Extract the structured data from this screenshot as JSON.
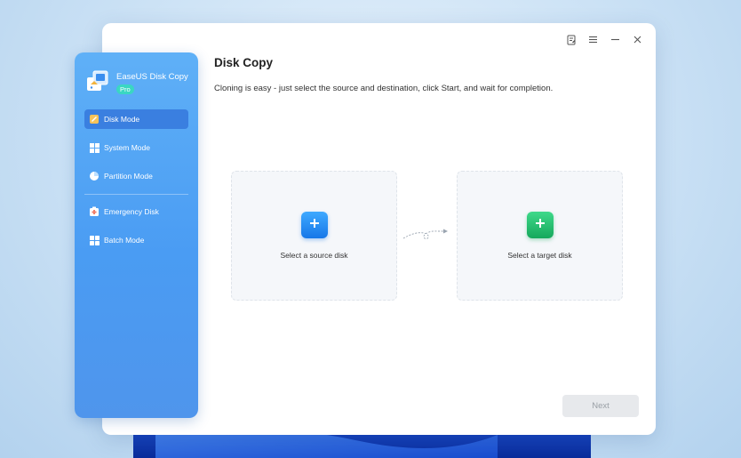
{
  "app": {
    "name": "EaseUS Disk Copy",
    "edition_badge": "Pro"
  },
  "sidebar": {
    "items": [
      {
        "label": "Disk Mode",
        "icon": "disk-icon",
        "active": true
      },
      {
        "label": "System Mode",
        "icon": "windows-icon",
        "active": false
      },
      {
        "label": "Partition Mode",
        "icon": "pie-chart-icon",
        "active": false
      },
      {
        "label": "Emergency Disk",
        "icon": "emergency-disk-icon",
        "active": false
      },
      {
        "label": "Batch Mode",
        "icon": "grid-icon",
        "active": false
      }
    ]
  },
  "titlebar": {
    "icons": [
      "feedback-icon",
      "menu-icon",
      "minimize-icon",
      "close-icon"
    ]
  },
  "main": {
    "title": "Disk Copy",
    "description": "Cloning is easy - just select the source and destination, click Start, and wait for completion.",
    "source_card": {
      "label": "Select a source disk",
      "icon": "plus-icon",
      "color": "#1677e8"
    },
    "target_card": {
      "label": "Select a target disk",
      "icon": "plus-icon",
      "color": "#16a85c"
    },
    "next_button": "Next",
    "next_enabled": false
  },
  "colors": {
    "sidebar_accent": "#4a9cf3",
    "active_item": "#3a7fe0",
    "pro_badge": "#3ad7c2"
  }
}
